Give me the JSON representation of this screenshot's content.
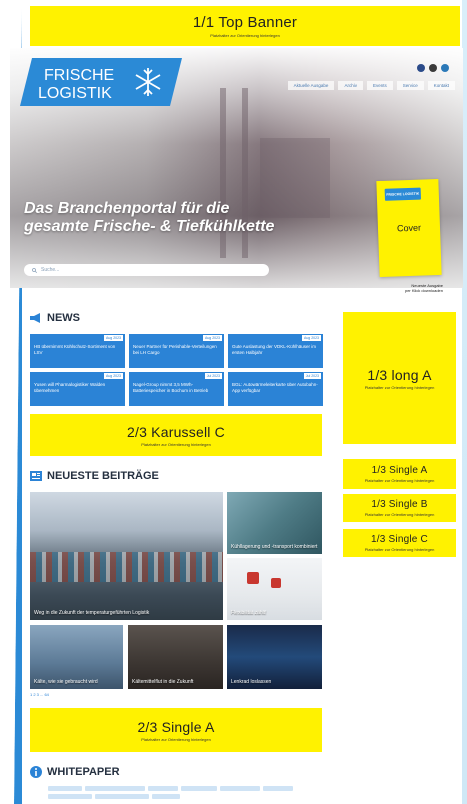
{
  "ads": {
    "top_banner": {
      "title": "1/1 Top Banner",
      "sub": "Platzhalter zur Orientierung hinterlegen"
    },
    "long_a": {
      "title": "1/3 long A",
      "sub": "Platzhalter zur Orientierung hinterlegen"
    },
    "karussell_c": {
      "title": "2/3 Karussell C",
      "sub": "Platzhalter zur Orientierung hinterlegen"
    },
    "single_a_side": {
      "title": "1/3 Single A",
      "sub": "Platzhalter zur Orientierung hinterlegen"
    },
    "single_b_side": {
      "title": "1/3 Single B",
      "sub": "Platzhalter zur Orientierung hinterlegen"
    },
    "single_c_side": {
      "title": "1/3 Single C",
      "sub": "Platzhalter zur Orientierung hinterlegen"
    },
    "single_a_main": {
      "title": "2/3 Single A",
      "sub": "Platzhalter zur Orientierung hinterlegen"
    }
  },
  "header": {
    "logo_line1": "FRISCHE",
    "logo_line2": "LOGISTIK",
    "nav": [
      "Aktuelle Ausgabe",
      "Archiv",
      "Events",
      "Service",
      "Kontakt"
    ],
    "social": [
      "facebook-icon",
      "instagram-icon",
      "linkedin-icon"
    ]
  },
  "hero": {
    "headline": "Das Branchenportal für die gesamte Frische- & Tiefkühlkette",
    "search_placeholder": "Suche...",
    "cover_label": "Cover",
    "cover_mini": "FRISCHE LOGISTIK",
    "cover_caption_1": "Neueste Ausgabe",
    "cover_caption_2": "per Klick downloaden"
  },
  "news": {
    "heading": "NEWS",
    "items": [
      {
        "date": "Aug 2023",
        "title": "HB übernimmt Kühlschutz-Sortiment von LSV"
      },
      {
        "date": "Aug 2023",
        "title": "Neuer Partner für Perishable-Verteilungen bei LH Cargo"
      },
      {
        "date": "Aug 2023",
        "title": "Gute Auslastung der VDKL-Kühlhäuser im ersten Halbjahr"
      },
      {
        "date": "Aug 2023",
        "title": "Yusen will Pharmalogistiker Walden übernehmen"
      },
      {
        "date": "Jul 2023",
        "title": "Nagel-Group nimmt 3,5 MWh-Batteriespeicher in Bochum in Betrieb"
      },
      {
        "date": "Jul 2023",
        "title": "BGL: Autowärmeleiterkarte über Autobahn-App verfügbar"
      }
    ]
  },
  "beitraege": {
    "heading": "NEUESTE BEITRÄGE",
    "items": [
      "Weg in die Zukunft der temperaturgeführten Logistik",
      "Kühllagerung und -transport kombiniert",
      "Flexibilität zählt!",
      "Kälte, wie sie gebraucht wird",
      "Kältemittelflut in die Zukunft",
      "Lenkrad loslassen"
    ],
    "pager": "1 2 3 ... 64"
  },
  "whitepaper": {
    "heading": "WHITEPAPER"
  }
}
